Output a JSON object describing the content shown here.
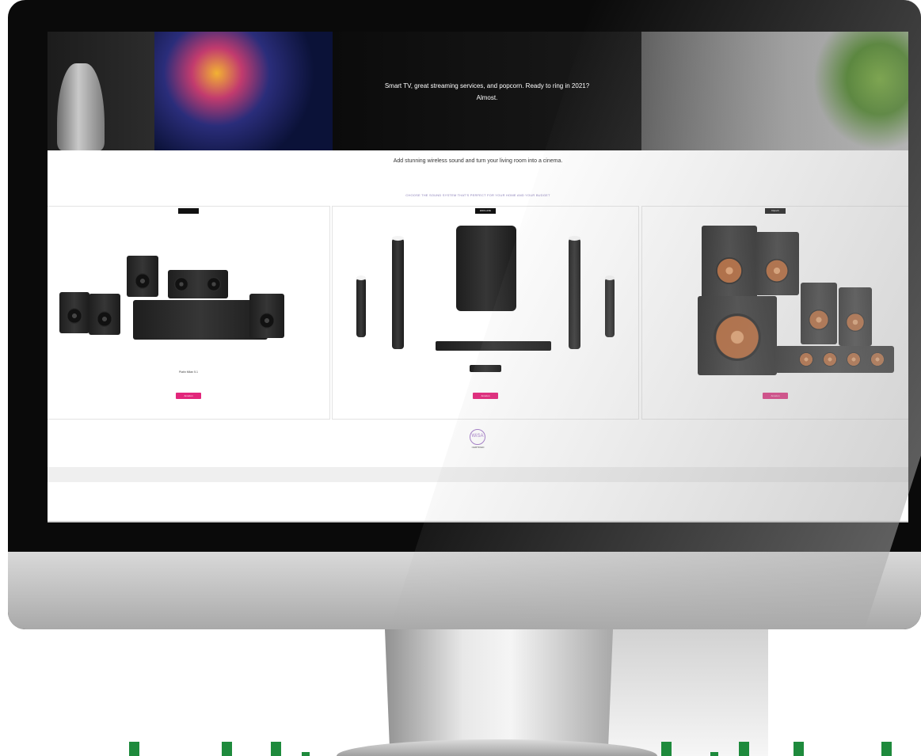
{
  "hero": {
    "line1": "Smart TV, great streaming services, and popcorn. Ready to ring in 2021?",
    "line2": "Almost."
  },
  "intro": {
    "title": "Add stunning wireless sound and turn your living room into a cinema.",
    "body": "",
    "link": "CHOOSE THE SOUND SYSTEM THAT'S PERFECT FOR YOUR HOME AND YOUR BUDGET"
  },
  "products": [
    {
      "brand": "",
      "name": "Platin Milan 5.1",
      "description": "",
      "button": "Amazon"
    },
    {
      "brand": "ENCLAVE",
      "name": "",
      "description": "",
      "button": "Amazon"
    },
    {
      "brand": "Klipsch",
      "name": "",
      "description": "",
      "button": "Amazon"
    }
  ],
  "certified": {
    "logo": "WiSA",
    "label": "CERTIFIED",
    "link": "",
    "text": ""
  },
  "footer": {
    "copyright": ""
  },
  "colors": {
    "accent": "#e2267b",
    "link": "#8a7fb8",
    "bezel": "#0a0a0a",
    "dots": "#1e8a3c"
  }
}
